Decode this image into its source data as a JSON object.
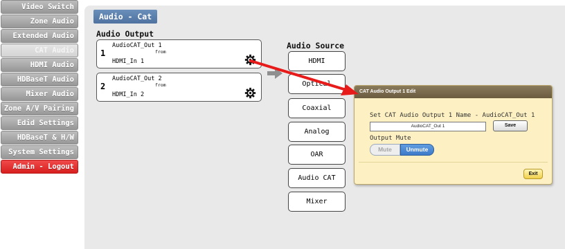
{
  "sidebar": {
    "items": [
      {
        "label": "Video Switch"
      },
      {
        "label": "Zone Audio"
      },
      {
        "label": "Extended Audio"
      },
      {
        "label": "CAT Audio"
      },
      {
        "label": "HDMI Audio"
      },
      {
        "label": "HDBaseT Audio"
      },
      {
        "label": "Mixer Audio"
      },
      {
        "label": "Zone A/V Pairing"
      },
      {
        "label": "Edid Settings"
      },
      {
        "label": "HDBaseT & H/W"
      },
      {
        "label": "System Settings"
      },
      {
        "label": "Admin - Logout"
      }
    ],
    "active": "CAT Audio"
  },
  "page": {
    "title": "Audio - Cat",
    "output_heading": "Audio Output",
    "source_heading": "Audio Source"
  },
  "outputs": [
    {
      "number": "1",
      "name": "AudioCAT_Out 1",
      "from_label": "from",
      "source": "HDMI_In 1"
    },
    {
      "number": "2",
      "name": "AudioCAT_Out 2",
      "from_label": "from",
      "source": "HDMI_In 2"
    }
  ],
  "sources": [
    "HDMI",
    "Optical",
    "Coaxial",
    "Analog",
    "OAR",
    "Audio CAT",
    "Mixer"
  ],
  "dialog": {
    "title": "CAT Audio Output 1 Edit",
    "name_label": "Set CAT Audio Output 1 Name - AudioCAT_Out 1",
    "name_value": "AudioCAT_Out 1",
    "save_label": "Save",
    "mute_heading": "Output Mute",
    "mute_label": "Mute",
    "unmute_label": "Unmute",
    "mute_state": "Unmute",
    "exit_label": "Exit"
  },
  "colors": {
    "title_bar": "#5b7fae",
    "logout": "#e02828",
    "dialog_bg": "#fdf0c2",
    "arrow": "#e81b1b",
    "unmute_active": "#4a88d6"
  },
  "icons": {
    "gear": "gear-icon",
    "arrow": "red-pointer-arrow"
  }
}
